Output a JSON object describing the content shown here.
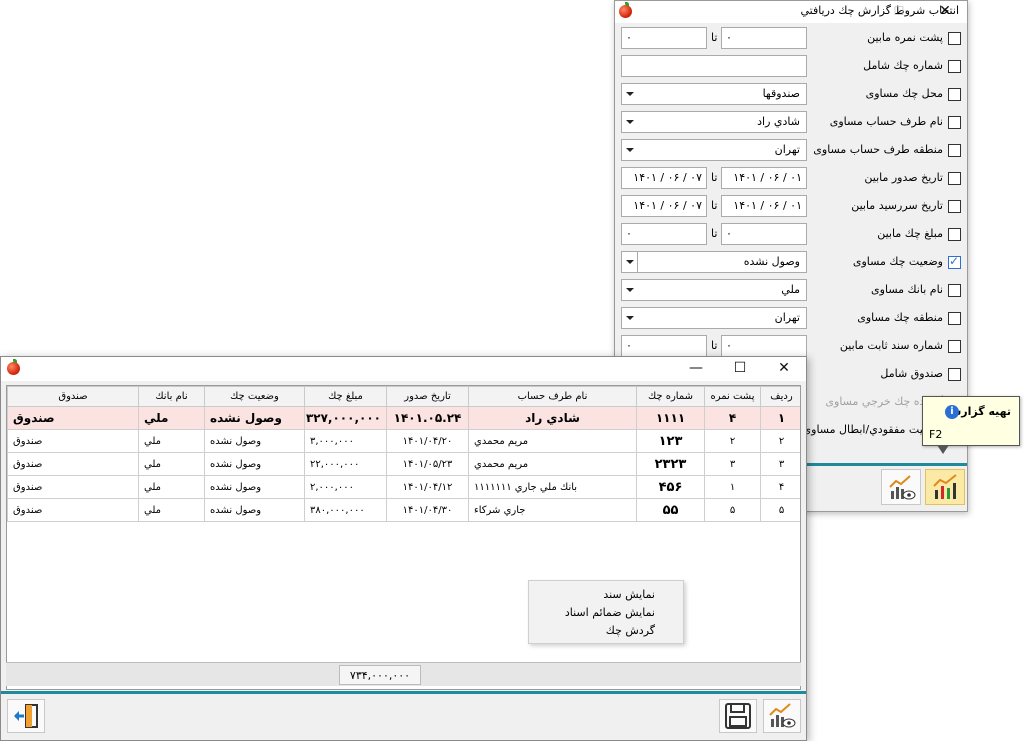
{
  "filter_window": {
    "title": "انتخاب شروط گزارش چك دريافتي",
    "controls": {
      "close": "✕",
      "maximize": "☐"
    },
    "to_label": "تا",
    "rows": [
      {
        "label": "پشت نمره مابين",
        "checked": false,
        "from": "۰",
        "to": "۰"
      },
      {
        "label": "شماره چك شامل",
        "checked": false,
        "value": ""
      },
      {
        "label": "محل چك مساوی",
        "checked": false,
        "value": "صندوقها"
      },
      {
        "label": "نام طرف حساب مساوی",
        "checked": false,
        "value": "شادي راد"
      },
      {
        "label": "منطقه طرف حساب مساوی",
        "checked": false,
        "value": "تهران"
      },
      {
        "label": "تاريخ صدور مابين",
        "checked": false,
        "from": "۰۱ / ۰۶ / ۱۴۰۱",
        "to": "۰۷ / ۰۶ / ۱۴۰۱"
      },
      {
        "label": "تاريخ سررسيد مابين",
        "checked": false,
        "from": "۰۱ / ۰۶ / ۱۴۰۱",
        "to": "۰۷ / ۰۶ / ۱۴۰۱"
      },
      {
        "label": "مبلغ چك مابين",
        "checked": false,
        "from": "۰",
        "to": "۰"
      },
      {
        "label": "وضعيت چك مساوی",
        "checked": true,
        "value": "وصول نشده"
      },
      {
        "label": "نام بانك مساوی",
        "checked": false,
        "value": "ملي"
      },
      {
        "label": "منطقه چك مساوی",
        "checked": false,
        "value": "تهران"
      },
      {
        "label": "شماره سند ثابت مابين",
        "checked": false,
        "from": "۰",
        "to": "۰"
      },
      {
        "label": "صندوق شامل",
        "checked": false
      },
      {
        "label": "گيرنده چك خرجي مساوی",
        "checked": false
      },
      {
        "label": "وضعيت مفقودي/ابطال مساوی",
        "checked": false
      }
    ]
  },
  "tooltip": {
    "title": "تهيه گزارش",
    "icon": "info-icon",
    "shortcut": "F2"
  },
  "report_window": {
    "controls": {
      "close": "✕",
      "maximize": "☐",
      "minimize": "—"
    },
    "columns": [
      "رديف",
      "پشت نمره",
      "شماره چك",
      "نام طرف حساب",
      "تاريخ صدور",
      "مبلغ چك",
      "وضعيت چك",
      "نام بانك",
      "صندوق"
    ],
    "rows": [
      [
        "۱",
        "۴",
        "۱۱۱۱",
        "شادي راد",
        "۱۴۰۱.۰۵.۲۴",
        "۳۲۷,۰۰۰,۰۰۰",
        "وصول نشده",
        "ملي",
        "صندوق"
      ],
      [
        "۲",
        "۲",
        "۱۲۳",
        "مريم محمدي",
        "۱۴۰۱/۰۴/۲۰",
        "۳,۰۰۰,۰۰۰",
        "وصول نشده",
        "ملي",
        "صندوق"
      ],
      [
        "۳",
        "۳",
        "۲۳۲۳",
        "مريم محمدي",
        "۱۴۰۱/۰۵/۲۳",
        "۲۲,۰۰۰,۰۰۰",
        "وصول نشده",
        "ملي",
        "صندوق"
      ],
      [
        "۴",
        "۱",
        "۴۵۶",
        "بانك ملي جاري ۱۱۱۱۱۱۱",
        "۱۴۰۱/۰۴/۱۲",
        "۲,۰۰۰,۰۰۰",
        "وصول نشده",
        "ملي",
        "صندوق"
      ],
      [
        "۵",
        "۵",
        "۵۵",
        "جاري شركاء",
        "۱۴۰۱/۰۴/۳۰",
        "۳۸۰,۰۰۰,۰۰۰",
        "وصول نشده",
        "ملي",
        "صندوق"
      ]
    ],
    "context_menu": [
      "نمايش سند",
      "نمايش ضمائم اسناد",
      "گردش چك"
    ],
    "total": "۷۳۴,۰۰۰,۰۰۰"
  },
  "colors": {
    "accent_line": "#1f8a99",
    "selected_row": "#fbe3e1",
    "tooltip_bg": "#ffffe1",
    "active_button": "#fbe9a6"
  }
}
